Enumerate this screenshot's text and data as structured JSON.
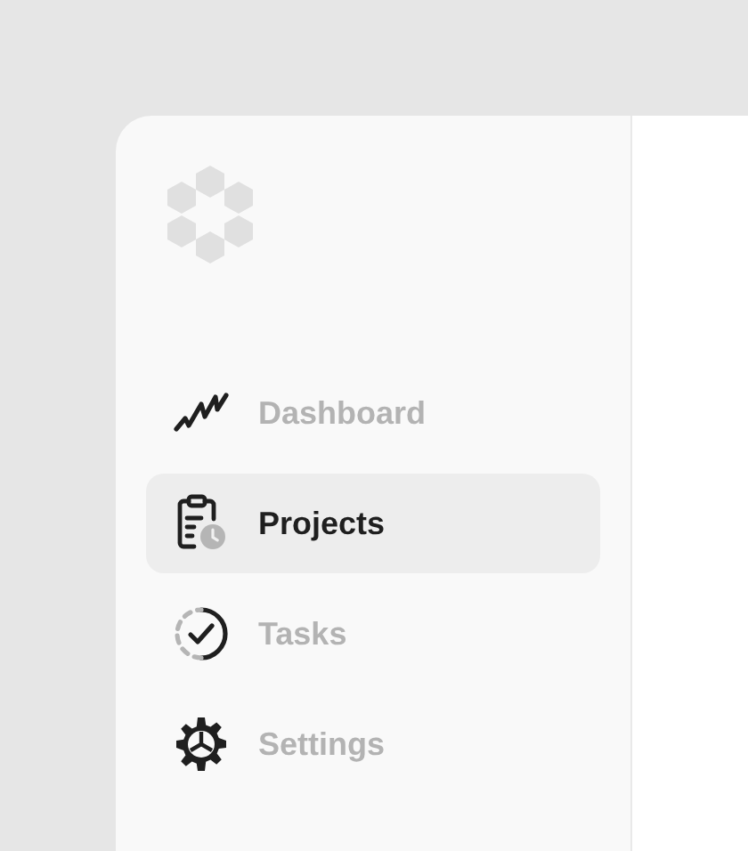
{
  "sidebar": {
    "items": [
      {
        "label": "Dashboard",
        "selected": false
      },
      {
        "label": "Projects",
        "selected": true
      },
      {
        "label": "Tasks",
        "selected": false
      },
      {
        "label": "Settings",
        "selected": false
      }
    ]
  }
}
